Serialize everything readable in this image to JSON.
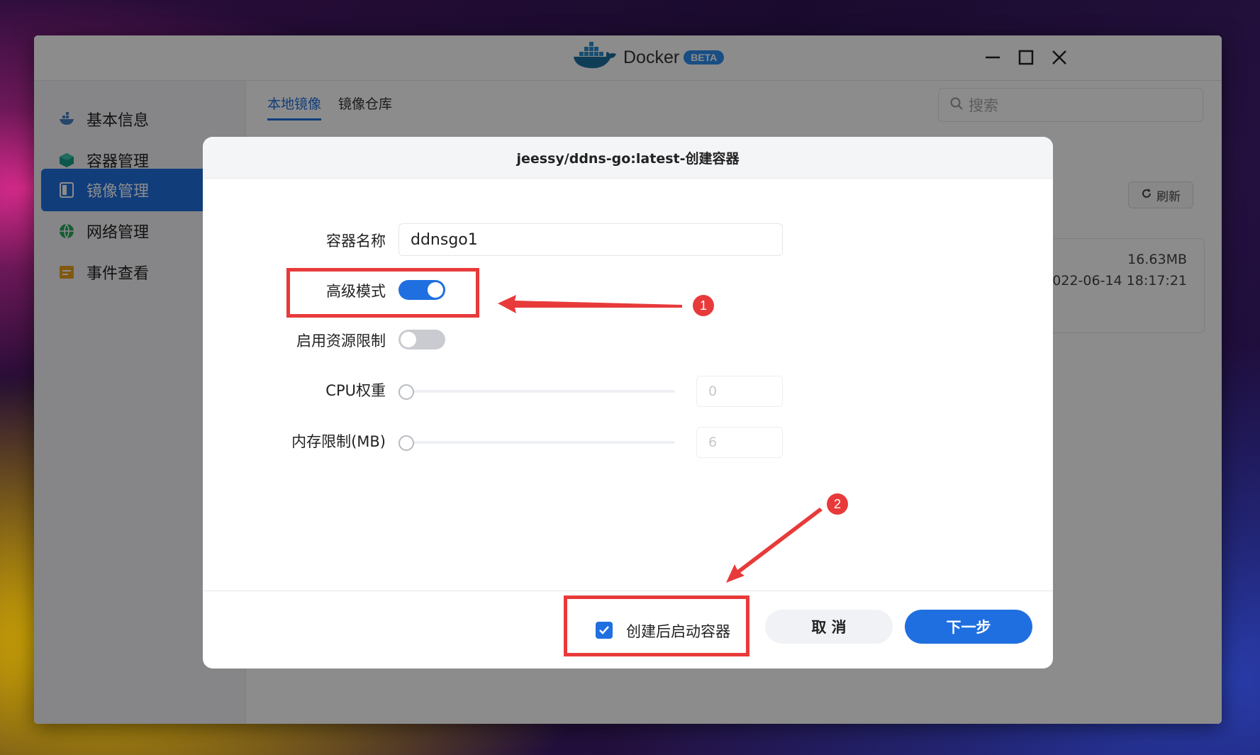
{
  "app": {
    "title": "Docker",
    "badge": "BETA"
  },
  "sidebar": {
    "items": [
      {
        "label": "基本信息",
        "icon": "docker-whale-icon"
      },
      {
        "label": "容器管理",
        "icon": "cube-icon"
      },
      {
        "label": "镜像管理",
        "icon": "image-icon",
        "active": true
      },
      {
        "label": "网络管理",
        "icon": "globe-icon"
      },
      {
        "label": "事件查看",
        "icon": "event-log-icon"
      }
    ]
  },
  "tabs": [
    {
      "label": "本地镜像",
      "active": true
    },
    {
      "label": "镜像仓库"
    }
  ],
  "search": {
    "placeholder": "搜索"
  },
  "toolbar": {
    "refresh_label": "刷新"
  },
  "image_card": {
    "size": "16.63MB",
    "date": "2022-06-14 18:17:21"
  },
  "modal": {
    "title": "jeessy/ddns-go:latest-创建容器",
    "name_label": "容器名称",
    "name_value": "ddnsgo1",
    "advanced_label": "高级模式",
    "advanced_on": true,
    "resource_label": "启用资源限制",
    "resource_on": false,
    "cpu_label": "CPU权重",
    "cpu_value": "0",
    "mem_label": "内存限制(MB)",
    "mem_value": "6",
    "start_after_create_label": "创建后启动容器",
    "start_after_create_checked": true,
    "cancel_label": "取 消",
    "next_label": "下一步"
  },
  "annotations": {
    "badge1": "1",
    "badge2": "2"
  },
  "colors": {
    "accent": "#1f6fe0",
    "annotation": "#e83a3a"
  }
}
